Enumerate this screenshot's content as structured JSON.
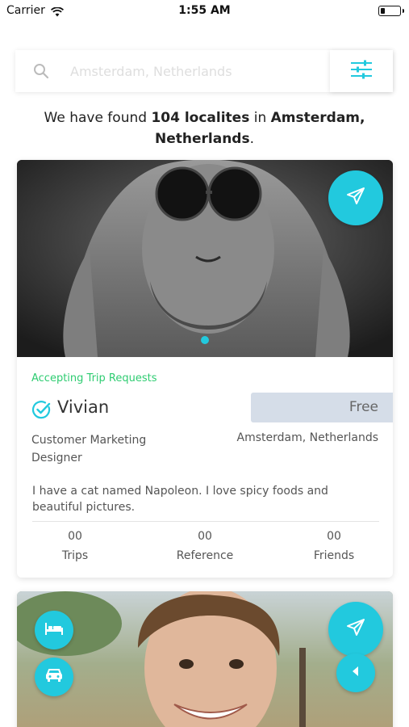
{
  "status_bar": {
    "carrier": "Carrier",
    "time": "1:55 AM"
  },
  "search": {
    "placeholder": "Amsterdam, Netherlands"
  },
  "results": {
    "prefix": "We have found ",
    "count": "104 localites",
    "middle": " in ",
    "city": "Amsterdam, Netherlands",
    "suffix": "."
  },
  "card": {
    "status": "Accepting Trip Requests",
    "name": "Vivian",
    "price": "Free",
    "occupation": "Customer Marketing Designer",
    "location": "Amsterdam, Netherlands",
    "bio": "I have a cat named Napoleon. I love spicy foods and beautiful pictures.",
    "stats": [
      {
        "value": "00",
        "label": "Trips"
      },
      {
        "value": "00",
        "label": "Reference"
      },
      {
        "value": "00",
        "label": "Friends"
      }
    ]
  },
  "colors": {
    "accent": "#22c9de",
    "status_green": "#2ecc71",
    "price_bg": "#d5dde8"
  },
  "icons": [
    "wifi-icon",
    "search-icon",
    "filter-sliders-icon",
    "send-icon",
    "verified-check-icon",
    "bed-icon",
    "car-icon",
    "chevron-left-icon"
  ]
}
